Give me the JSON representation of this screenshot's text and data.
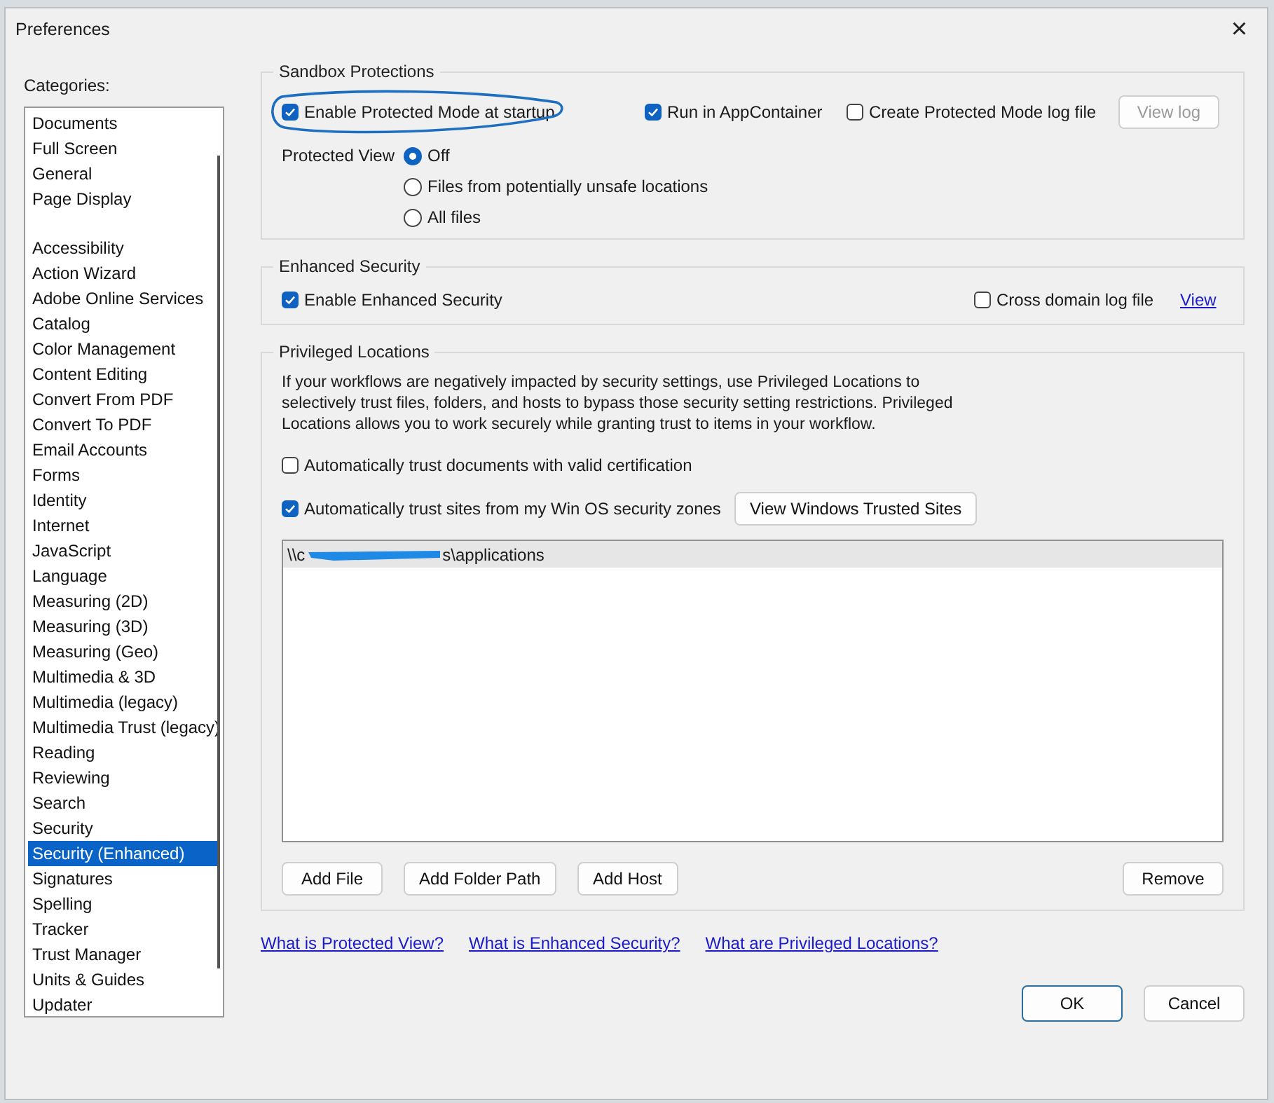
{
  "window": {
    "title": "Preferences",
    "close": "×"
  },
  "categories": {
    "label": "Categories:",
    "groups": [
      {
        "items": [
          {
            "label": "Documents",
            "selected": false
          },
          {
            "label": "Full Screen",
            "selected": false
          },
          {
            "label": "General",
            "selected": false
          },
          {
            "label": "Page Display",
            "selected": false
          }
        ]
      },
      {
        "items": [
          {
            "label": "Accessibility",
            "selected": false
          },
          {
            "label": "Action Wizard",
            "selected": false
          },
          {
            "label": "Adobe Online Services",
            "selected": false
          },
          {
            "label": "Catalog",
            "selected": false
          },
          {
            "label": "Color Management",
            "selected": false
          },
          {
            "label": "Content Editing",
            "selected": false
          },
          {
            "label": "Convert From PDF",
            "selected": false
          },
          {
            "label": "Convert To PDF",
            "selected": false
          },
          {
            "label": "Email Accounts",
            "selected": false
          },
          {
            "label": "Forms",
            "selected": false
          },
          {
            "label": "Identity",
            "selected": false
          },
          {
            "label": "Internet",
            "selected": false
          },
          {
            "label": "JavaScript",
            "selected": false
          },
          {
            "label": "Language",
            "selected": false
          },
          {
            "label": "Measuring (2D)",
            "selected": false
          },
          {
            "label": "Measuring (3D)",
            "selected": false
          },
          {
            "label": "Measuring (Geo)",
            "selected": false
          },
          {
            "label": "Multimedia & 3D",
            "selected": false
          },
          {
            "label": "Multimedia (legacy)",
            "selected": false
          },
          {
            "label": "Multimedia Trust (legacy)",
            "selected": false
          },
          {
            "label": "Reading",
            "selected": false
          },
          {
            "label": "Reviewing",
            "selected": false
          },
          {
            "label": "Search",
            "selected": false
          },
          {
            "label": "Security",
            "selected": false
          },
          {
            "label": "Security (Enhanced)",
            "selected": true
          },
          {
            "label": "Signatures",
            "selected": false
          },
          {
            "label": "Spelling",
            "selected": false
          },
          {
            "label": "Tracker",
            "selected": false
          },
          {
            "label": "Trust Manager",
            "selected": false
          },
          {
            "label": "Units & Guides",
            "selected": false
          },
          {
            "label": "Updater",
            "selected": false
          }
        ]
      }
    ]
  },
  "sandbox": {
    "title": "Sandbox Protections",
    "options": [
      {
        "label": "Enable Protected Mode at startup",
        "checked": true,
        "circled": true
      },
      {
        "label": "Run in AppContainer",
        "checked": true,
        "circled": false
      },
      {
        "label": "Create Protected Mode log file",
        "checked": false,
        "circled": false
      }
    ],
    "view_log": {
      "label": "View log",
      "disabled": true
    },
    "protected_view": {
      "label": "Protected View",
      "options": [
        {
          "label": "Off",
          "selected": true
        },
        {
          "label": "Files from potentially unsafe locations",
          "selected": false
        },
        {
          "label": "All files",
          "selected": false
        }
      ]
    }
  },
  "enhanced": {
    "title": "Enhanced Security",
    "enable": {
      "label": "Enable Enhanced Security",
      "checked": true
    },
    "cross_domain": {
      "label": "Cross domain log file",
      "checked": false
    },
    "view_link": "View"
  },
  "privileged": {
    "title": "Privileged Locations",
    "description": "If your workflows are negatively impacted by security settings, use Privileged Locations to selectively trust files, folders, and hosts to bypass those security setting restrictions. Privileged Locations allows you to work securely while granting trust to items in your workflow.",
    "trust_certified": {
      "label": "Automatically trust documents with valid certification",
      "checked": false
    },
    "trust_sites": {
      "label": "Automatically trust sites from my Win OS security zones",
      "checked": true
    },
    "view_sites_button": "View Windows Trusted Sites",
    "locations": [
      {
        "start": "\\\\c",
        "end": "s\\applications",
        "redacted": true,
        "selected": true
      }
    ],
    "buttons": [
      "Add File",
      "Add Folder Path",
      "Add Host"
    ],
    "remove_button": "Remove"
  },
  "links": [
    "What is Protected View?",
    "What is Enhanced Security?",
    "What are Privileged Locations?"
  ],
  "footer": [
    {
      "label": "OK",
      "default": true
    },
    {
      "label": "Cancel",
      "default": false
    }
  ]
}
